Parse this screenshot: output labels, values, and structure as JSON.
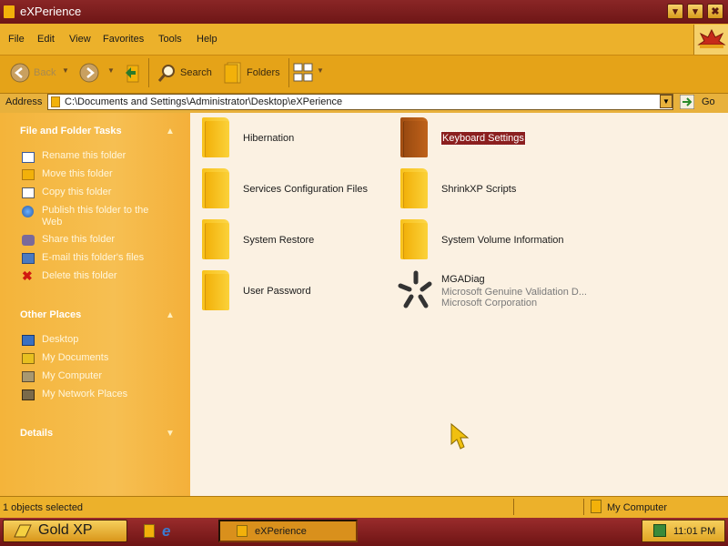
{
  "window": {
    "title": "eXPerience",
    "btn_min": "▾",
    "btn_max": "▾",
    "btn_close": "✖"
  },
  "menu": [
    "File",
    "Edit",
    "View",
    "Favorites",
    "Tools",
    "Help"
  ],
  "toolbar": {
    "back": "Back",
    "search": "Search",
    "folders": "Folders"
  },
  "address": {
    "label": "Address",
    "path": "C:\\Documents and Settings\\Administrator\\Desktop\\eXPerience",
    "go": "Go"
  },
  "left_pane": {
    "file_tasks": {
      "title": "File and Folder Tasks",
      "items": [
        "Rename this folder",
        "Move this folder",
        "Copy this folder",
        "Publish this folder to the",
        "Web",
        "Share this folder",
        "E-mail this folder's files",
        "Delete this folder"
      ]
    },
    "other_places": {
      "title": "Other Places",
      "items": [
        "Desktop",
        "My Documents",
        "My Computer",
        "My Network Places"
      ]
    },
    "details": {
      "title": "Details"
    }
  },
  "content": {
    "items": [
      {
        "name": "Hibernation"
      },
      {
        "name": "Keyboard Settings",
        "selected": true
      },
      {
        "name": "Services Configuration Files"
      },
      {
        "name": "ShrinkXP Scripts"
      },
      {
        "name": "System Restore"
      },
      {
        "name": "System Volume Information"
      },
      {
        "name": "User Password"
      },
      {
        "name": "MGADiag",
        "line2": "Microsoft Genuine Validation D...",
        "line3": "Microsoft Corporation"
      }
    ]
  },
  "status": {
    "left": "1 objects selected",
    "right": "My Computer"
  },
  "taskbar": {
    "start": "Gold XP",
    "window": "eXPerience",
    "clock": "11:01 PM"
  },
  "colors": {
    "accent": "#ecb12b",
    "title": "#7a1e1e",
    "selection": "#8b1f1f"
  }
}
